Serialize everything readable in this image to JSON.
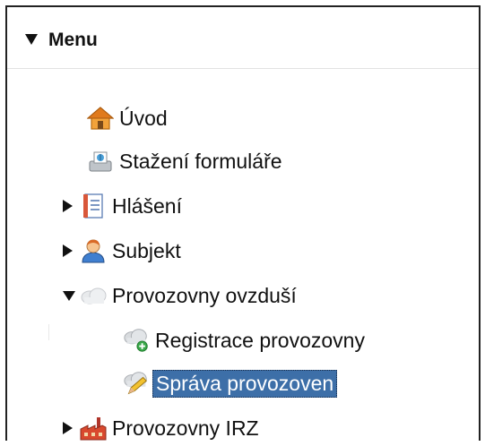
{
  "menu": {
    "title": "Menu",
    "items": [
      {
        "label": "Úvod",
        "icon": "home-icon",
        "toggle": "none"
      },
      {
        "label": "Stažení formuláře",
        "icon": "download-form-icon",
        "toggle": "none"
      },
      {
        "label": "Hlášení",
        "icon": "notebook-icon",
        "toggle": "collapsed"
      },
      {
        "label": "Subjekt",
        "icon": "user-icon",
        "toggle": "collapsed"
      },
      {
        "label": "Provozovny ovzduší",
        "icon": "cloud-icon",
        "toggle": "expanded"
      },
      {
        "label": "Registrace provozovny",
        "icon": "cloud-add-icon",
        "toggle": "none"
      },
      {
        "label": "Správa provozoven",
        "icon": "cloud-edit-icon",
        "toggle": "none",
        "selected": true
      },
      {
        "label": "Provozovny IRZ",
        "icon": "factory-icon",
        "toggle": "collapsed"
      }
    ]
  },
  "colors": {
    "selection": "#3d6fa8",
    "border": "#222222"
  }
}
